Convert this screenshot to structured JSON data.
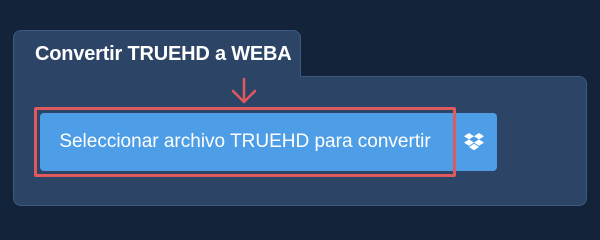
{
  "panel": {
    "title": "Convertir TRUEHD a WEBA"
  },
  "upload": {
    "select_button_label": "Seleccionar archivo TRUEHD para convertir",
    "dropbox_icon": "dropbox-icon"
  },
  "colors": {
    "background": "#13233a",
    "panel": "#2c4567",
    "button": "#4d9ee6",
    "highlight": "#e05a5d"
  }
}
